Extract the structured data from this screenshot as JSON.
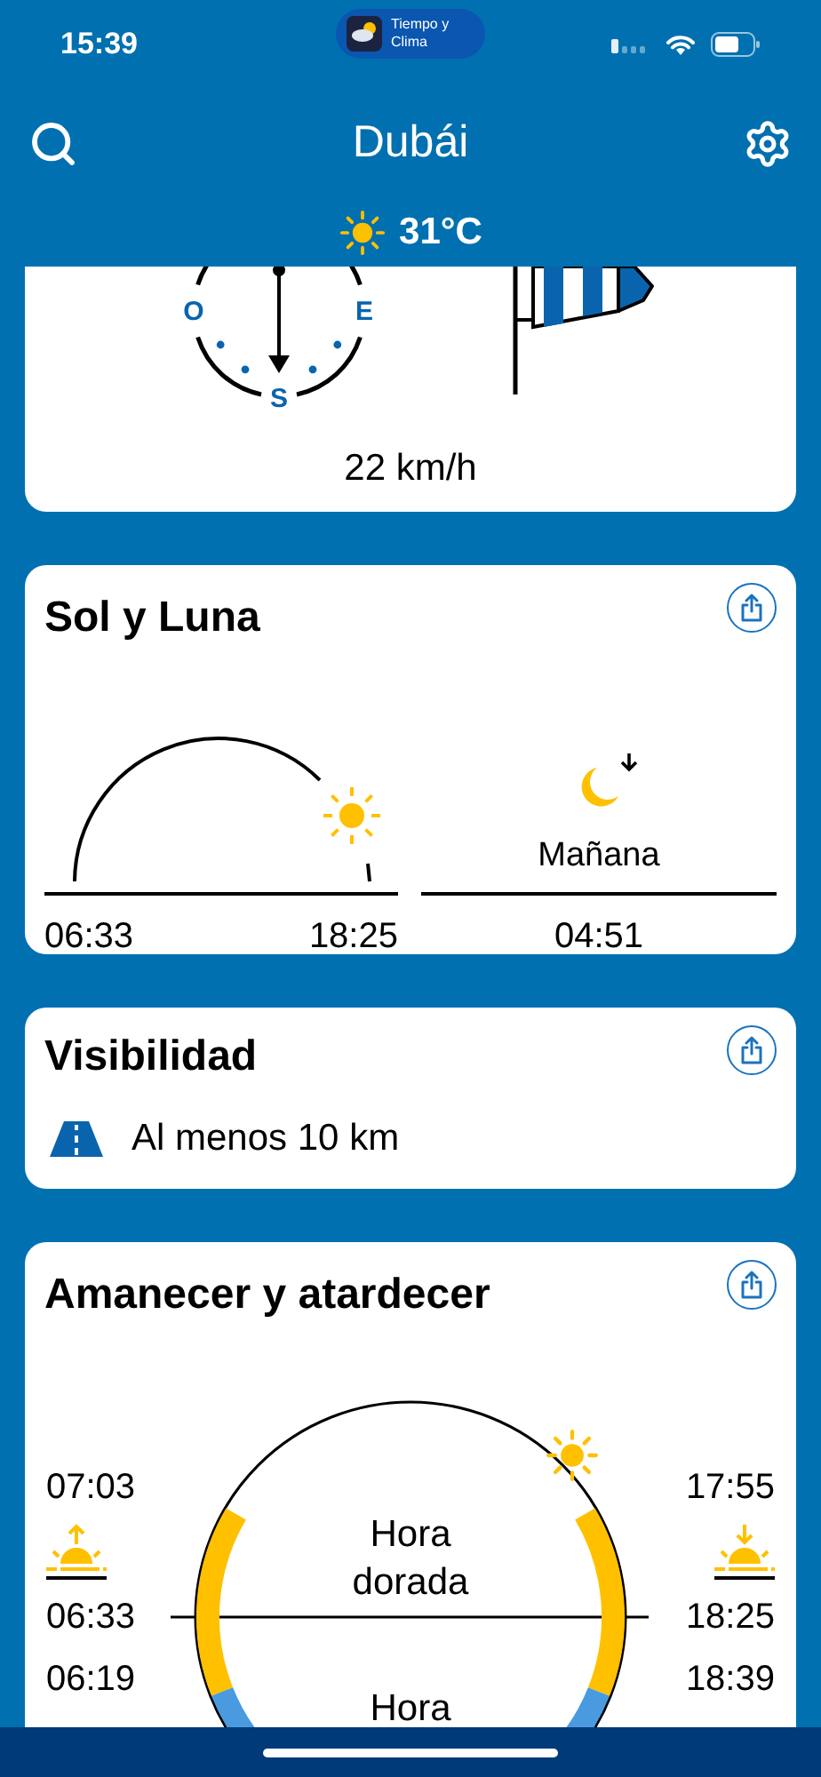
{
  "status_bar": {
    "time": "15:39",
    "app_badge": "Tiempo y Clima"
  },
  "header": {
    "city": "Dubái",
    "temperature": "31°C"
  },
  "wind": {
    "compass": [
      {
        "kind": "west",
        "label": "O"
      },
      {
        "kind": "east",
        "label": "E"
      },
      {
        "kind": "south",
        "label": "S"
      }
    ],
    "speed": "22 km/h"
  },
  "sun_moon": {
    "title": "Sol y Luna",
    "sunrise": "06:33",
    "sunset": "18:25",
    "moon_label": "Mañana",
    "moonrise": "04:51"
  },
  "visibility": {
    "title": "Visibilidad",
    "value": "Al menos 10 km"
  },
  "sunrise_sunset": {
    "title": "Amanecer y atardecer",
    "left_times": [
      "07:03",
      "06:33",
      "06:19"
    ],
    "right_times": [
      "17:55",
      "18:25",
      "18:39"
    ],
    "golden_label": "Hora dorada",
    "blue_label": "Hora"
  }
}
